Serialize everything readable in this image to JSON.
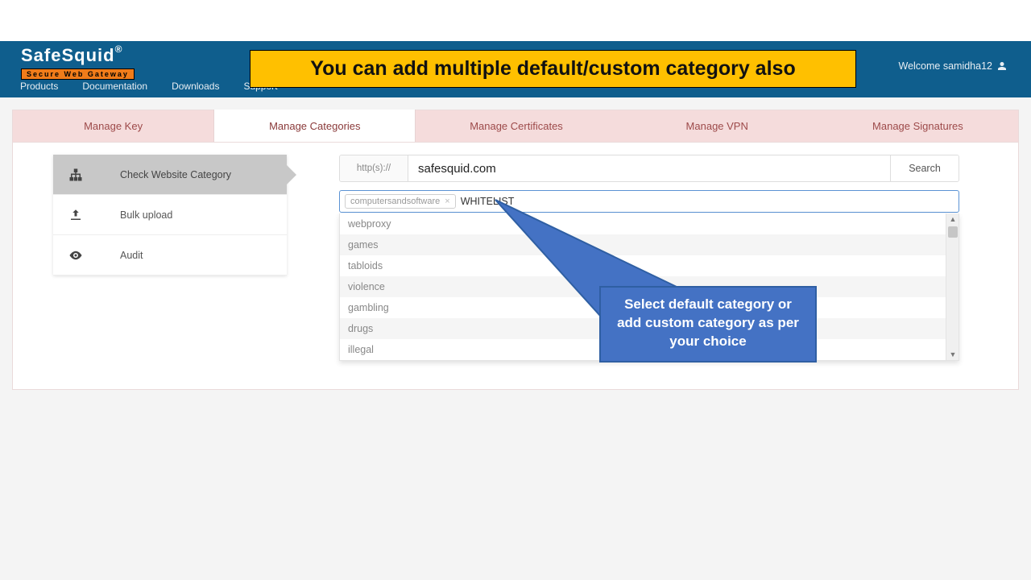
{
  "header": {
    "logo_main": "SafeSquid",
    "logo_reg": "®",
    "logo_sub": "Secure Web Gateway",
    "nav": {
      "products": "Products",
      "documentation": "Documentation",
      "downloads": "Downloads",
      "support": "Support"
    },
    "welcome": "Welcome samidha12"
  },
  "banner": "You can add multiple default/custom category also",
  "tabs": {
    "manage_key": "Manage Key",
    "manage_categories": "Manage Categories",
    "manage_certificates": "Manage Certificates",
    "manage_vpn": "Manage VPN",
    "manage_signatures": "Manage Signatures"
  },
  "sidenav": {
    "check": "Check Website Category",
    "bulk": "Bulk upload",
    "audit": "Audit"
  },
  "search": {
    "prefix": "http(s)://",
    "value": "safesquid.com",
    "button": "Search"
  },
  "tags": {
    "selected": "computersandsoftware",
    "input_value": "WHITELIST"
  },
  "dropdown": [
    "webproxy",
    "games",
    "tabloids",
    "violence",
    "gambling",
    "drugs",
    "illegal"
  ],
  "callout": "Select default category or add custom category as per your choice"
}
